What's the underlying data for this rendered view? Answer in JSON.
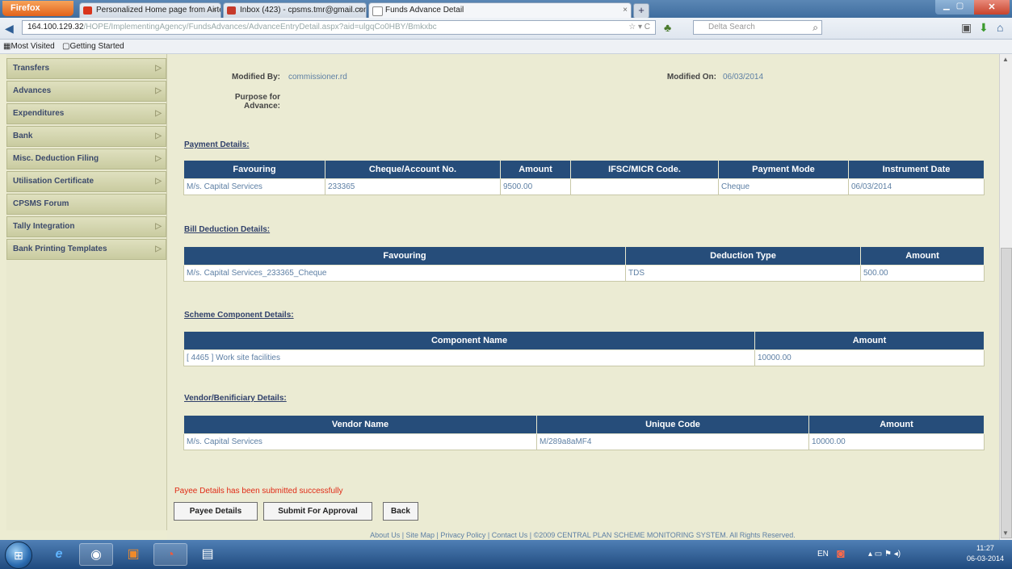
{
  "browser": {
    "menu_label": "Firefox",
    "tabs": [
      {
        "label": "Personalized Home page from Airtel ...",
        "icon_color": "#d9341c"
      },
      {
        "label": "Inbox (423) - cpsms.tmr@gmail.com - ...",
        "icon_color": "#c63a2b"
      },
      {
        "label": "Funds Advance Detail",
        "icon_color": "#ffffff"
      }
    ],
    "new_tab_label": "+",
    "url_host": "164.100.129.32",
    "url_path": "/HOPE/ImplementingAgency/FundsAdvances/AdvanceEntryDetail.aspx?aid=ulgqCo0HBY/Bmkxbc",
    "search_placeholder": "Delta Search",
    "bookmarks": [
      "Most Visited",
      "Getting Started"
    ]
  },
  "sidebar": {
    "items": [
      {
        "label": "Transfers",
        "has_arrow": true
      },
      {
        "label": "Advances",
        "has_arrow": true
      },
      {
        "label": "Expenditures",
        "has_arrow": true
      },
      {
        "label": "Bank",
        "has_arrow": true
      },
      {
        "label": "Misc. Deduction Filing",
        "has_arrow": true
      },
      {
        "label": "Utilisation Certificate",
        "has_arrow": true
      },
      {
        "label": "CPSMS Forum",
        "has_arrow": false
      },
      {
        "label": "Tally Integration",
        "has_arrow": true
      },
      {
        "label": "Bank Printing Templates",
        "has_arrow": true
      }
    ],
    "arrow_glyph": "▷"
  },
  "details": {
    "modified_by_label": "Modified By:",
    "modified_by_value": "commissioner.rd",
    "modified_on_label": "Modified On:",
    "modified_on_value": "06/03/2014",
    "purpose_label_1": "Purpose for",
    "purpose_label_2": "Advance:"
  },
  "payment": {
    "title": "Payment Details:",
    "headers": [
      "Favouring",
      "Cheque/Account No.",
      "Amount",
      "IFSC/MICR Code.",
      "Payment Mode",
      "Instrument Date"
    ],
    "row": [
      "M/s. Capital Services",
      "233365",
      "9500.00",
      "",
      "Cheque",
      "06/03/2014"
    ]
  },
  "bill_deduction": {
    "title": "Bill Deduction Details:",
    "headers": [
      "Favouring",
      "Deduction Type",
      "Amount"
    ],
    "row": [
      "M/s. Capital Services_233365_Cheque",
      "TDS",
      "500.00"
    ]
  },
  "scheme_component": {
    "title": "Scheme Component Details:",
    "headers": [
      "Component Name",
      "Amount"
    ],
    "row": [
      "[ 4465 ] Work site facilities",
      "10000.00"
    ]
  },
  "vendor": {
    "title": "Vendor/Benificiary Details:",
    "headers": [
      "Vendor Name",
      "Unique Code",
      "Amount"
    ],
    "row": [
      "M/s. Capital Services",
      "M/289a8aMF4",
      "10000.00"
    ]
  },
  "status_message": "Payee Details has been submitted successfully",
  "buttons": {
    "payee": "Payee Details",
    "submit": "Submit For Approval",
    "back": "Back"
  },
  "footer": "About Us | Site Map | Privacy Policy | Contact Us | ©2009 CENTRAL PLAN SCHEME MONITORING SYSTEM. All Rights Reserved.",
  "taskbar": {
    "language": "EN",
    "time": "11:27",
    "date": "06-03-2014"
  }
}
